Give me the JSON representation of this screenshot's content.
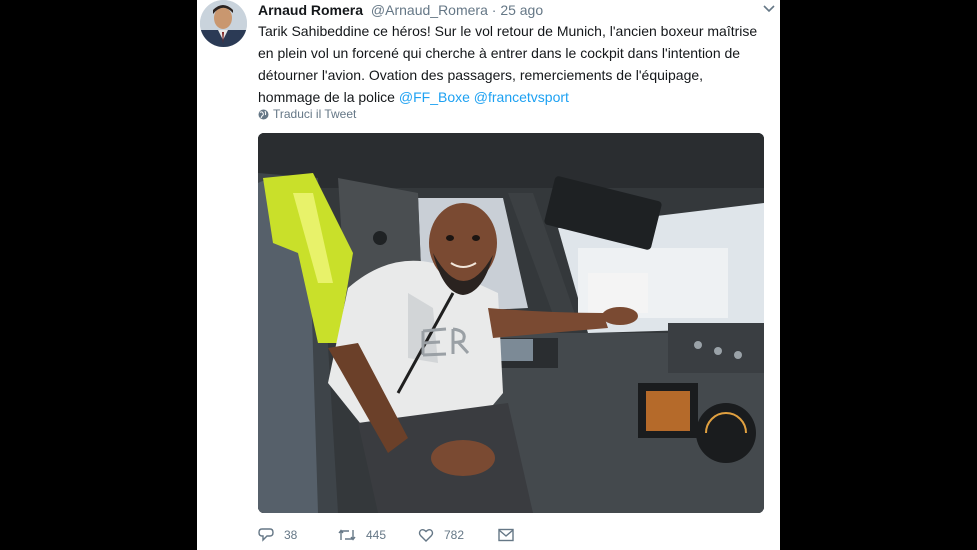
{
  "tweet": {
    "author_name": "Arnaud Romera",
    "author_handle": "@Arnaud_Romera",
    "separator": "·",
    "timestamp": "25 ago",
    "text_part": "Tarik Sahibeddine ce héros! Sur le vol retour de Munich, l'ancien boxeur maîtrise en plein vol un forcené qui cherche à entrer dans le cockpit dans l'intention de détourner l'avion. Ovation des passagers, remerciements de l'équipage, hommage de la police",
    "mentions": [
      "@FF_Boxe",
      "@francetvsport"
    ],
    "translate_label": "Traduci il Tweet"
  },
  "actions": {
    "replies": "38",
    "retweets": "445",
    "likes": "782"
  },
  "icons": {
    "menu": "chevron-down-icon",
    "translate": "globe-icon",
    "reply": "reply-icon",
    "retweet": "retweet-icon",
    "like": "heart-icon",
    "dm": "envelope-icon"
  },
  "colors": {
    "link": "#1da1f2",
    "muted": "#657786",
    "text": "#14171a"
  }
}
